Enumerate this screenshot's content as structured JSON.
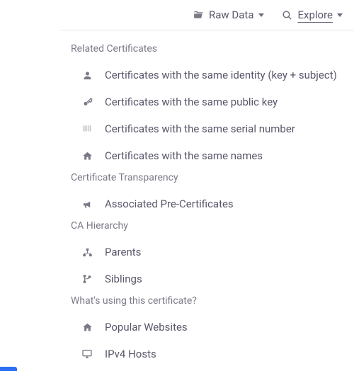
{
  "topbar": {
    "raw_data_label": "Raw Data",
    "explore_label": "Explore"
  },
  "sections": {
    "related": {
      "title": "Related Certificates"
    },
    "ct": {
      "title": "Certificate Transparency"
    },
    "ca": {
      "title": "CA Hierarchy"
    },
    "using": {
      "title": "What's using this certificate?"
    }
  },
  "items": {
    "same_identity": "Certificates with the same identity (key + subject)",
    "same_public_key": "Certificates with the same public key",
    "same_serial": "Certificates with the same serial number",
    "same_names": "Certificates with the same names",
    "pre_certs": "Associated Pre-Certificates",
    "parents": "Parents",
    "siblings": "Siblings",
    "popular_sites": "Popular Websites",
    "ipv4_hosts": "IPv4 Hosts"
  }
}
